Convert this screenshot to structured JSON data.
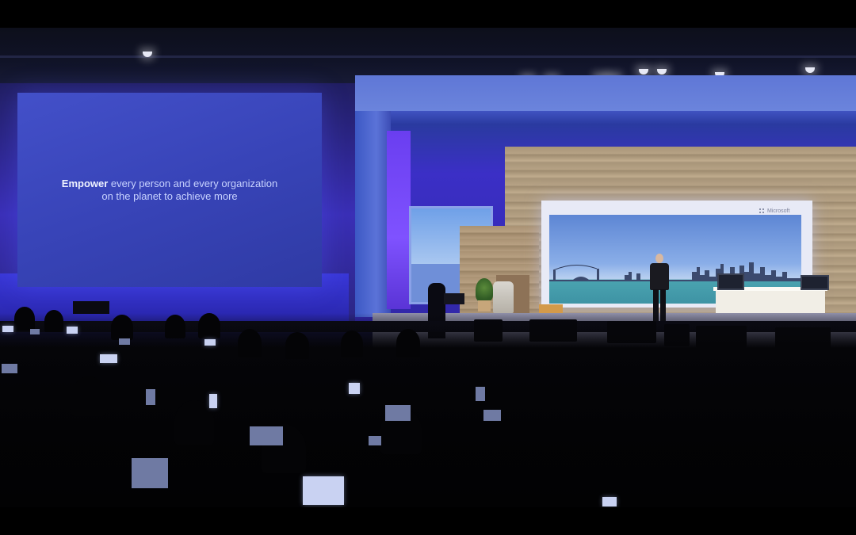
{
  "slide": {
    "line1_emphasis": "Empower",
    "line1_rest": " every person and every organization",
    "line2": "on the planet to achieve more"
  },
  "stage_logo": {
    "text": "Microsoft"
  },
  "colors": {
    "slide_background": "#3a46bb",
    "stage_purple": "#3b2fc6",
    "wood": "#b6a285",
    "letterbox": "#000000"
  }
}
